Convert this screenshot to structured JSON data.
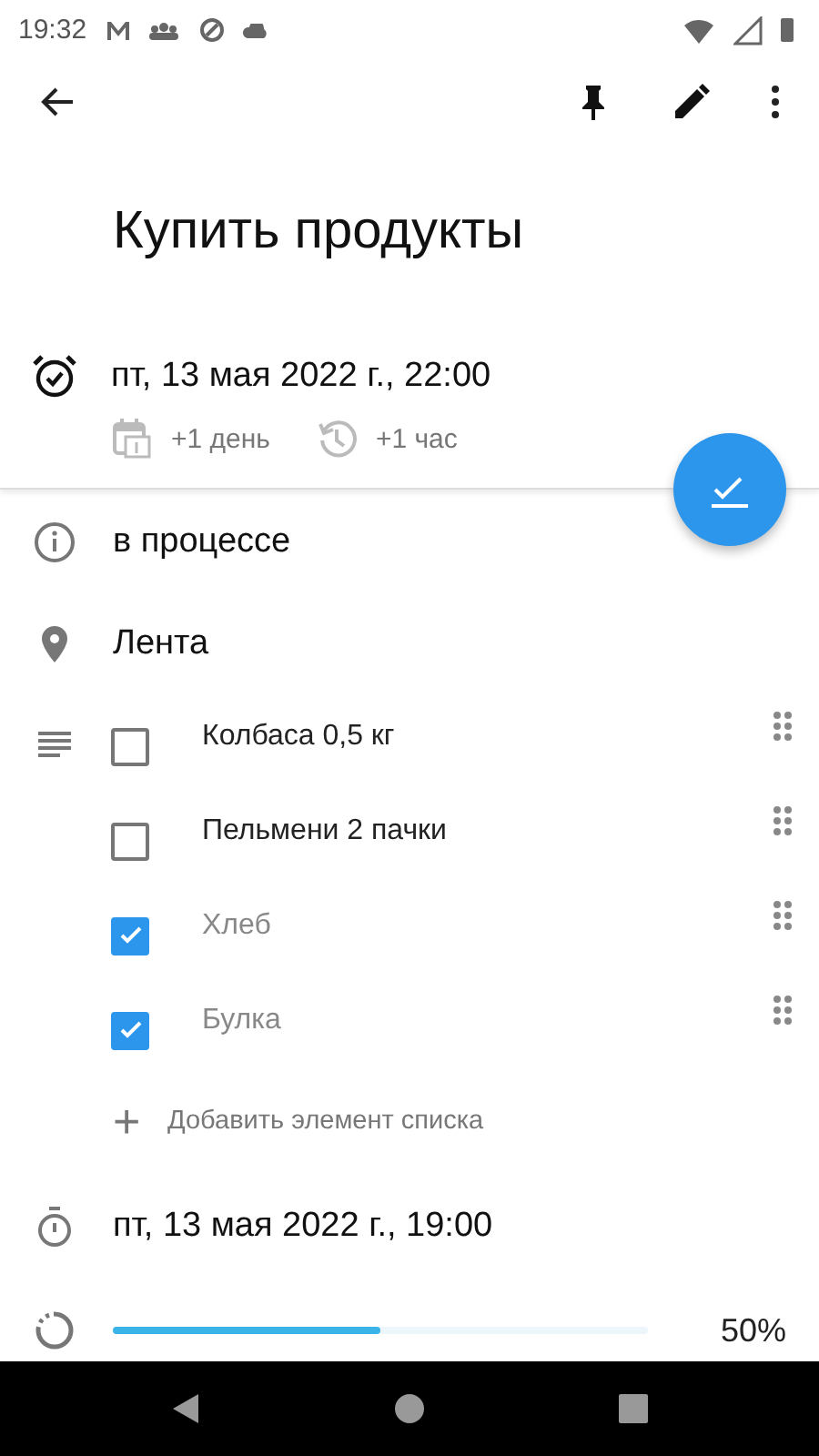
{
  "status_bar": {
    "time": "19:32"
  },
  "title": "Купить продукты",
  "reminder": {
    "date": "пт, 13 мая 2022 г., 22:00",
    "snooze": [
      "+1 день",
      "+1 час"
    ]
  },
  "status": "в процессе",
  "location": "Лента",
  "checklist": [
    {
      "text": "Колбаса 0,5 кг",
      "checked": false
    },
    {
      "text": "Пельмени 2 пачки",
      "checked": false
    },
    {
      "text": "Хлеб",
      "checked": true
    },
    {
      "text": "Булка",
      "checked": true
    }
  ],
  "add_item": {
    "icon": "+",
    "label": "Добавить элемент списка"
  },
  "due": "пт, 13 мая 2022 г., 19:00",
  "progress": {
    "level": 0.5,
    "reading": "50%"
  }
}
